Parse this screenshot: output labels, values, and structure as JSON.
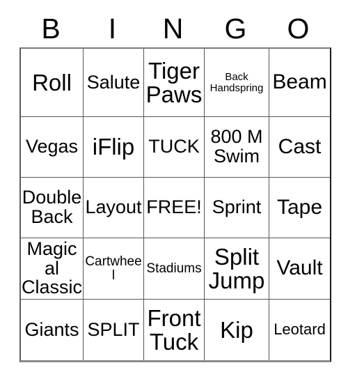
{
  "card": {
    "title_letters": [
      "B",
      "I",
      "N",
      "G",
      "O"
    ],
    "free_space_label": "FREE!",
    "colors": {
      "background": "#ffffff",
      "text": "#000000",
      "grid_line": "#555555",
      "grid_outer": "#1a1a1a"
    },
    "grid": {
      "columns": 5,
      "rows": 5,
      "cells": [
        {
          "text": "Roll",
          "size": "sz-xl"
        },
        {
          "text": "Salute",
          "size": "sz-md"
        },
        {
          "text": "Tiger Paws",
          "size": "sz-xl"
        },
        {
          "text": "Back Handspring",
          "size": "sz-xxs"
        },
        {
          "text": "Beam",
          "size": "sz-lg"
        },
        {
          "text": "Vegas",
          "size": "sz-md"
        },
        {
          "text": "iFlip",
          "size": "sz-xl"
        },
        {
          "text": "TUCK",
          "size": "sz-md"
        },
        {
          "text": "800 M Swim",
          "size": "sz-md"
        },
        {
          "text": "Cast",
          "size": "sz-lg"
        },
        {
          "text": "Double Back",
          "size": "sz-md"
        },
        {
          "text": "Layout",
          "size": "sz-md"
        },
        {
          "text": "FREE!",
          "size": "sz-md"
        },
        {
          "text": "Sprint",
          "size": "sz-md"
        },
        {
          "text": "Tape",
          "size": "sz-lg"
        },
        {
          "text": "Magical Classic",
          "size": "sz-md"
        },
        {
          "text": "Cartwheel",
          "size": "sz-xs"
        },
        {
          "text": "Stadiums",
          "size": "sz-xs"
        },
        {
          "text": "Split Jump",
          "size": "sz-xl"
        },
        {
          "text": "Vault",
          "size": "sz-lg"
        },
        {
          "text": "Giants",
          "size": "sz-md"
        },
        {
          "text": "SPLIT",
          "size": "sz-md"
        },
        {
          "text": "Front Tuck",
          "size": "sz-xl"
        },
        {
          "text": "Kip",
          "size": "sz-xl"
        },
        {
          "text": "Leotard",
          "size": "sz-sm"
        }
      ]
    }
  }
}
